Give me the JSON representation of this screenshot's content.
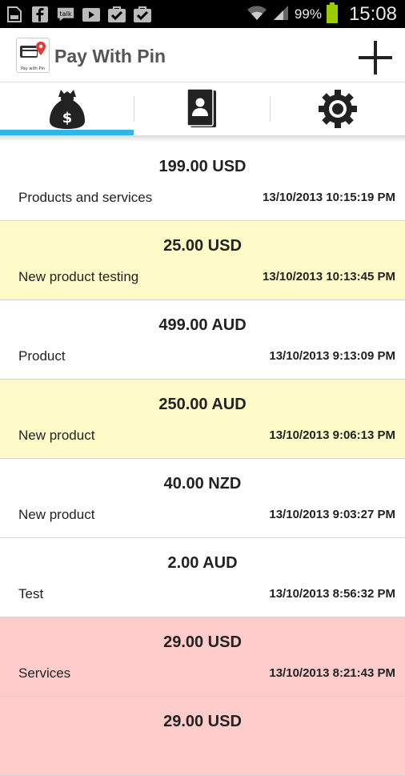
{
  "status_bar": {
    "battery_percent": "99%",
    "time": "15:08",
    "icons": [
      "sd-card-icon",
      "facebook-icon",
      "talk-icon",
      "play-store-icon",
      "task-check-icon",
      "task-check-icon",
      "wifi-icon",
      "signal-icon",
      "battery-icon"
    ]
  },
  "app": {
    "title": "Pay With Pin",
    "logo_text": "Pay with Pin"
  },
  "tabs": [
    {
      "name": "payments",
      "icon": "money-bag-icon",
      "selected": true
    },
    {
      "name": "contacts",
      "icon": "address-book-icon",
      "selected": false
    },
    {
      "name": "settings",
      "icon": "gear-icon",
      "selected": false
    }
  ],
  "colors": {
    "accent": "#33b5e5",
    "row_default": "#ffffff",
    "row_highlight": "#fffbc8",
    "row_alert": "#ffcccc"
  },
  "transactions": [
    {
      "amount": "199.00 USD",
      "description": "Products and services",
      "datetime": "13/10/2013 10:15:19 PM",
      "status": "default"
    },
    {
      "amount": "25.00 USD",
      "description": "New product testing",
      "datetime": "13/10/2013 10:13:45 PM",
      "status": "highlight"
    },
    {
      "amount": "499.00 AUD",
      "description": "Product",
      "datetime": "13/10/2013 9:13:09 PM",
      "status": "default"
    },
    {
      "amount": "250.00 AUD",
      "description": "New product",
      "datetime": "13/10/2013 9:06:13 PM",
      "status": "highlight"
    },
    {
      "amount": "40.00 NZD",
      "description": "New product",
      "datetime": "13/10/2013 9:03:27 PM",
      "status": "default"
    },
    {
      "amount": "2.00 AUD",
      "description": "Test",
      "datetime": "13/10/2013 8:56:32 PM",
      "status": "default"
    },
    {
      "amount": "29.00 USD",
      "description": "Services",
      "datetime": "13/10/2013 8:21:43 PM",
      "status": "alert"
    },
    {
      "amount": "29.00 USD",
      "description": "",
      "datetime": "",
      "status": "alert"
    }
  ]
}
